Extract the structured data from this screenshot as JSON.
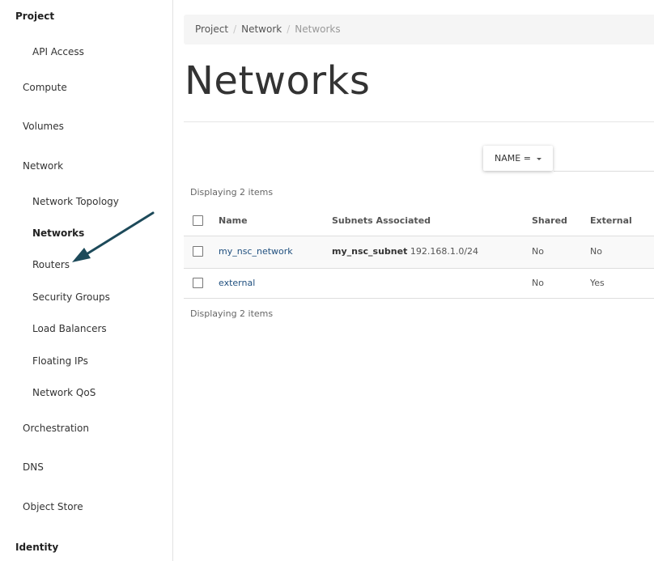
{
  "sidebar": {
    "project": "Project",
    "api_access": "API Access",
    "compute": "Compute",
    "volumes": "Volumes",
    "network": "Network",
    "network_items": [
      "Network Topology",
      "Networks",
      "Routers",
      "Security Groups",
      "Load Balancers",
      "Floating IPs",
      "Network QoS"
    ],
    "orchestration": "Orchestration",
    "dns": "DNS",
    "object_store": "Object Store",
    "identity": "Identity"
  },
  "breadcrumb": [
    "Project",
    "Network",
    "Networks"
  ],
  "page": {
    "title": "Networks"
  },
  "filter": {
    "label": "NAME ="
  },
  "count_text": "Displaying 2 items",
  "table": {
    "headers": [
      "Name",
      "Subnets Associated",
      "Shared",
      "External"
    ],
    "rows": [
      {
        "name": "my_nsc_network",
        "subnet_name": "my_nsc_subnet",
        "subnet_cidr": "192.168.1.0/24",
        "shared": "No",
        "external": "No"
      },
      {
        "name": "external",
        "subnet_name": "",
        "subnet_cidr": "",
        "shared": "No",
        "external": "Yes"
      }
    ]
  },
  "annotation": {
    "arrow_color": "#1d4a5a"
  }
}
